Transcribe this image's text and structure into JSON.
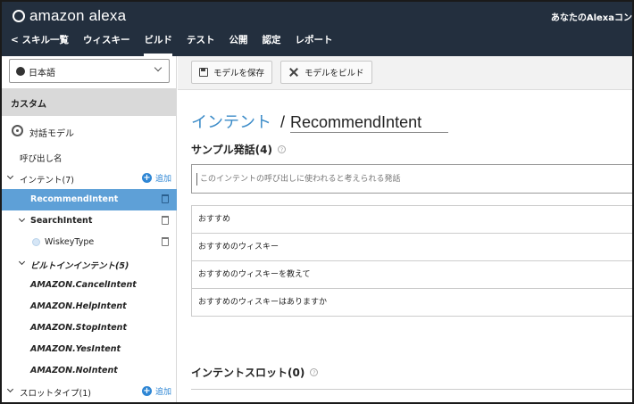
{
  "app": {
    "logo_text": "amazon alexa",
    "account_label": "あなたのAlexaコン"
  },
  "nav": {
    "items": [
      {
        "label": "< スキル一覧",
        "active": false
      },
      {
        "label": "ウィスキー",
        "active": false
      },
      {
        "label": "ビルド",
        "active": true
      },
      {
        "label": "テスト",
        "active": false
      },
      {
        "label": "公開",
        "active": false
      },
      {
        "label": "認定",
        "active": false
      },
      {
        "label": "レポート",
        "active": false
      }
    ]
  },
  "sidebar": {
    "language": "日本語",
    "section": "カスタム",
    "model_label": "対話モデル",
    "invocation_label": "呼び出し名",
    "intents_label": "インテント(7)",
    "add_label": "追加",
    "intents": [
      {
        "label": "RecommendIntent",
        "selected": true
      },
      {
        "label": "SearchIntent",
        "selected": false
      },
      {
        "label": "WiskeyType",
        "selected": false
      }
    ],
    "builtin_label": "ビルトインインテント(5)",
    "builtins": [
      "AMAZON.CancelIntent",
      "AMAZON.HelpIntent",
      "AMAZON.StopIntent",
      "AMAZON.YesIntent",
      "AMAZON.NoIntent"
    ],
    "slot_types_label": "スロットタイプ(1)"
  },
  "toolbar": {
    "save_label": "モデルを保存",
    "build_label": "モデルをビルド"
  },
  "main": {
    "title_prefix": "インテント",
    "title_sep": "/",
    "intent_name": "RecommendIntent",
    "samples_heading": "サンプル発話(4)",
    "sample_placeholder": "このインテントの呼び出しに使われると考えられる発話",
    "samples": [
      "おすすめ",
      "おすすめのウィスキー",
      "おすすめのウィスキーを教えて",
      "おすすめのウィスキーはありますか"
    ],
    "slots_heading": "インテントスロット(0)",
    "help_glyph": "?"
  }
}
